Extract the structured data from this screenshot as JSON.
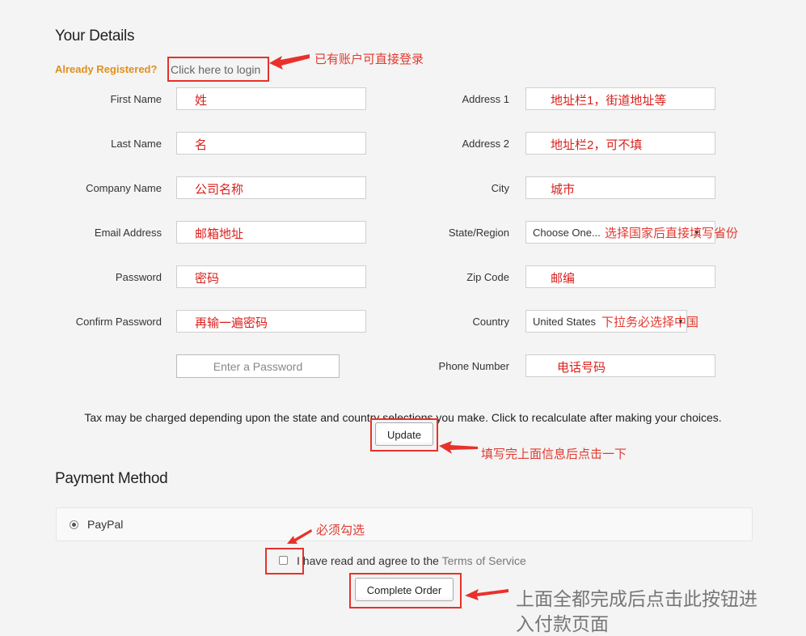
{
  "your_details": {
    "title": "Your Details",
    "already_registered": "Already Registered?",
    "login_link": "Click here to login",
    "login_note": "已有账户可直接登录"
  },
  "left_fields": [
    {
      "label": "First Name",
      "value": "姓"
    },
    {
      "label": "Last Name",
      "value": "名"
    },
    {
      "label": "Company Name",
      "value": "公司名称"
    },
    {
      "label": "Email Address",
      "value": "邮箱地址"
    },
    {
      "label": "Password",
      "value": "密码"
    },
    {
      "label": "Confirm Password",
      "value": "再输一遍密码"
    }
  ],
  "password_strength": "Enter a Password",
  "right_fields": {
    "address1": {
      "label": "Address 1",
      "value": "地址栏1，街道地址等"
    },
    "address2": {
      "label": "Address 2",
      "value": "地址栏2，可不填"
    },
    "city": {
      "label": "City",
      "value": "城市"
    },
    "state": {
      "label": "State/Region",
      "value": "Choose One...",
      "note": "选择国家后直接填写省份"
    },
    "zip": {
      "label": "Zip Code",
      "value": "邮编"
    },
    "country": {
      "label": "Country",
      "value": "United States",
      "note": "下拉务必选择中国"
    },
    "phone": {
      "label": "Phone Number",
      "value": "电话号码"
    }
  },
  "tax_text": "Tax may be charged depending upon the state and country selections you make. Click to recalculate after making your choices.",
  "update_button": "Update",
  "update_note": "填写完上面信息后点击一下",
  "payment": {
    "title": "Payment Method",
    "option": "PayPal",
    "checkbox_note": "必须勾选",
    "agree_text": "I have read and agree to the",
    "tos_link": "Terms of Service",
    "complete_button": "Complete Order",
    "complete_note_line1": "上面全都完成后点击此按钮进",
    "complete_note_line2": "入付款页面"
  },
  "colors": {
    "accent_orange": "#e0901a",
    "annotation_red": "#e8312a"
  }
}
